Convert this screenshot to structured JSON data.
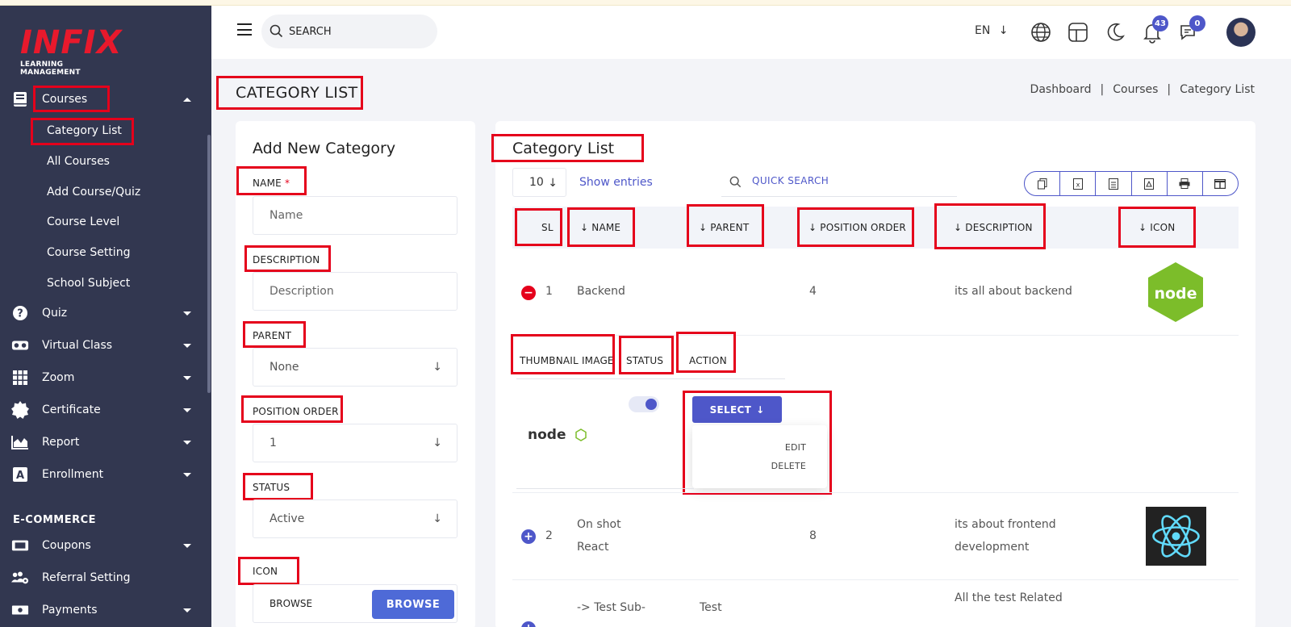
{
  "brand": {
    "logo_main": "INFIX",
    "logo_sub": "LEARNING MANAGEMENT"
  },
  "header": {
    "search_placeholder": "SEARCH",
    "language": "EN",
    "notifications_count": "43",
    "messages_count": "0"
  },
  "sidebar": {
    "items": [
      {
        "label": "Courses",
        "icon": "book-icon",
        "expanded": true
      },
      {
        "label": "Quiz",
        "icon": "question-circle-icon"
      },
      {
        "label": "Virtual Class",
        "icon": "vr-headset-icon"
      },
      {
        "label": "Zoom",
        "icon": "grid-icon"
      },
      {
        "label": "Certificate",
        "icon": "certificate-seal-icon"
      },
      {
        "label": "Report",
        "icon": "area-chart-icon"
      },
      {
        "label": "Enrollment",
        "icon": "letter-a-box-icon"
      }
    ],
    "course_sub_items": [
      "Category List",
      "All Courses",
      "Add Course/Quiz",
      "Course Level",
      "Course Setting",
      "School Subject"
    ],
    "ecommerce_heading": "E-COMMERCE",
    "ecommerce_items": [
      {
        "label": "Coupons",
        "icon": "ticket-icon"
      },
      {
        "label": "Referral Setting",
        "icon": "users-gear-icon"
      },
      {
        "label": "Payments",
        "icon": "money-icon"
      }
    ]
  },
  "page": {
    "title": "CATEGORY LIST",
    "breadcrumb": [
      "Dashboard",
      "Courses",
      "Category List"
    ]
  },
  "form": {
    "title": "Add New Category",
    "name_label": "NAME",
    "name_required": "*",
    "name_placeholder": "Name",
    "description_label": "DESCRIPTION",
    "description_placeholder": "Description",
    "parent_label": "PARENT",
    "parent_value": "None",
    "position_label": "POSITION ORDER",
    "position_value": "1",
    "status_label": "STATUS",
    "status_value": "Active",
    "icon_label": "ICON",
    "browse_text": "BROWSE",
    "browse_button": "BROWSE"
  },
  "list": {
    "title": "Category List",
    "entries_value": "10",
    "show_entries": "Show entries",
    "quick_search": "QUICK SEARCH",
    "columns": [
      "SL",
      "NAME",
      "PARENT",
      "POSITION ORDER",
      "DESCRIPTION",
      "ICON"
    ],
    "sub_columns": [
      "THUMBNAIL IMAGE",
      "STATUS",
      "ACTION"
    ],
    "rows": [
      {
        "sl": "1",
        "name": "Backend",
        "parent": "",
        "position": "4",
        "description": "its all about backend"
      },
      {
        "sl": "2",
        "name_line1": "On shot",
        "name_line2": "React",
        "parent": "",
        "position": "8",
        "description_line1": "its about frontend",
        "description_line2": "development"
      },
      {
        "name": "-> Test Sub-",
        "parent": "Test",
        "description": "All the test Related"
      }
    ],
    "select_button": "SELECT",
    "dropdown_items": [
      "EDIT",
      "DELETE"
    ],
    "node_text": "node",
    "node_thumb_text": "node"
  },
  "colors": {
    "sidebar_bg": "#323750",
    "accent": "#4e57c9",
    "brand_red": "#e8192c",
    "highlight_red": "#e5001b"
  }
}
